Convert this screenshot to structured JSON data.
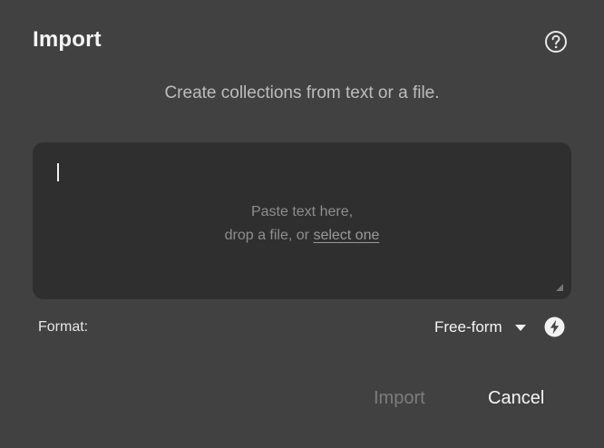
{
  "dialog": {
    "title": "Import",
    "subtitle": "Create collections from text or a file."
  },
  "text_area": {
    "hint_line1": "Paste text here,",
    "hint_line2_prefix": "drop a file, or ",
    "hint_link": "select one"
  },
  "format": {
    "label": "Format:",
    "selected": "Free-form"
  },
  "actions": {
    "import_label": "Import",
    "cancel_label": "Cancel"
  },
  "icons": {
    "help": "help-circle-icon",
    "format_dropdown": "chevron-down-icon",
    "auto_detect": "lightning-bolt-icon"
  }
}
